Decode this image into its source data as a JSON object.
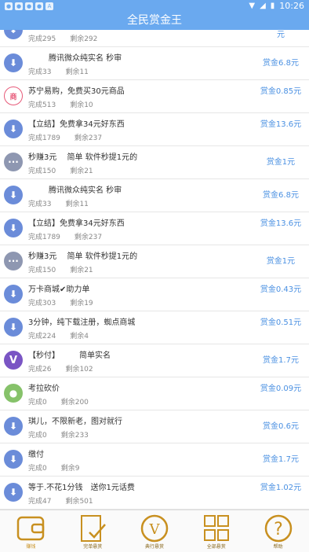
{
  "status": {
    "time": "10:26"
  },
  "title": "全民赏金王",
  "rows": [
    {
      "icon": "down",
      "title": "",
      "done": "完成295",
      "left": "剩余292",
      "reward": "元",
      "two": false,
      "partial": true
    },
    {
      "icon": "down",
      "title": "腾讯微众纯实名 秒审",
      "done": "完成33",
      "left": "剩余11",
      "reward": "赏金6.8元",
      "two": false
    },
    {
      "icon": "shop",
      "title": "苏宁易购，免费买30元商品",
      "done": "完成513",
      "left": "剩余10",
      "reward": "赏金0.85元",
      "two": true
    },
    {
      "icon": "down",
      "title": "【立结】免费拿34元好东西",
      "done": "完成1789",
      "left": "剩余237",
      "reward": "赏金13.6元",
      "two": true
    },
    {
      "icon": "dots",
      "title": "秒赚3元　 简单 软件秒提1元的",
      "done": "完成150",
      "left": "剩余21",
      "reward": "赏金1元",
      "two": false
    },
    {
      "icon": "down",
      "title": "腾讯微众纯实名 秒审",
      "done": "完成33",
      "left": "剩余11",
      "reward": "赏金6.8元",
      "two": false
    },
    {
      "icon": "down",
      "title": "【立结】免费拿34元好东西",
      "done": "完成1789",
      "left": "剩余237",
      "reward": "赏金13.6元",
      "two": true
    },
    {
      "icon": "dots",
      "title": "秒赚3元　 简单 软件秒提1元的",
      "done": "完成150",
      "left": "剩余21",
      "reward": "赏金1元",
      "two": false
    },
    {
      "icon": "down",
      "title": "万卡商城✔助力单",
      "done": "完成303",
      "left": "剩余19",
      "reward": "赏金0.43元",
      "two": true
    },
    {
      "icon": "down",
      "title": "3分钟，纯下载注册，蜘点商城",
      "done": "完成224",
      "left": "剩余4",
      "reward": "赏金0.51元",
      "two": true
    },
    {
      "icon": "v",
      "title": "【秒付】　　　简单实名",
      "done": "完成26",
      "left": "剩余102",
      "reward": "赏金1.7元",
      "two": false
    },
    {
      "icon": "user",
      "title": "考拉砍价",
      "done": "完成0",
      "left": "剩余200",
      "reward": "赏金0.09元",
      "two": true
    },
    {
      "icon": "down",
      "title": "琪儿，不限新老，图对就行",
      "done": "完成0",
      "left": "剩余233",
      "reward": "赏金0.6元",
      "two": false
    },
    {
      "icon": "down",
      "title": "缴付",
      "done": "完成0",
      "left": "剩余9",
      "reward": "赏金1.7元",
      "two": false
    },
    {
      "icon": "down",
      "title": "等于.不花1分钱　送你1元话费",
      "done": "完成47",
      "left": "剩余501",
      "reward": "赏金1.02元",
      "two": true
    }
  ],
  "tabs": [
    {
      "label": "赚钱",
      "icon": "wallet-icon"
    },
    {
      "label": "完单悬赏",
      "icon": "paper-check-icon"
    },
    {
      "label": "典行悬赏",
      "icon": "v-badge-icon"
    },
    {
      "label": "全部悬赏",
      "icon": "grid-icon"
    },
    {
      "label": "帮助",
      "icon": "help-icon"
    }
  ]
}
